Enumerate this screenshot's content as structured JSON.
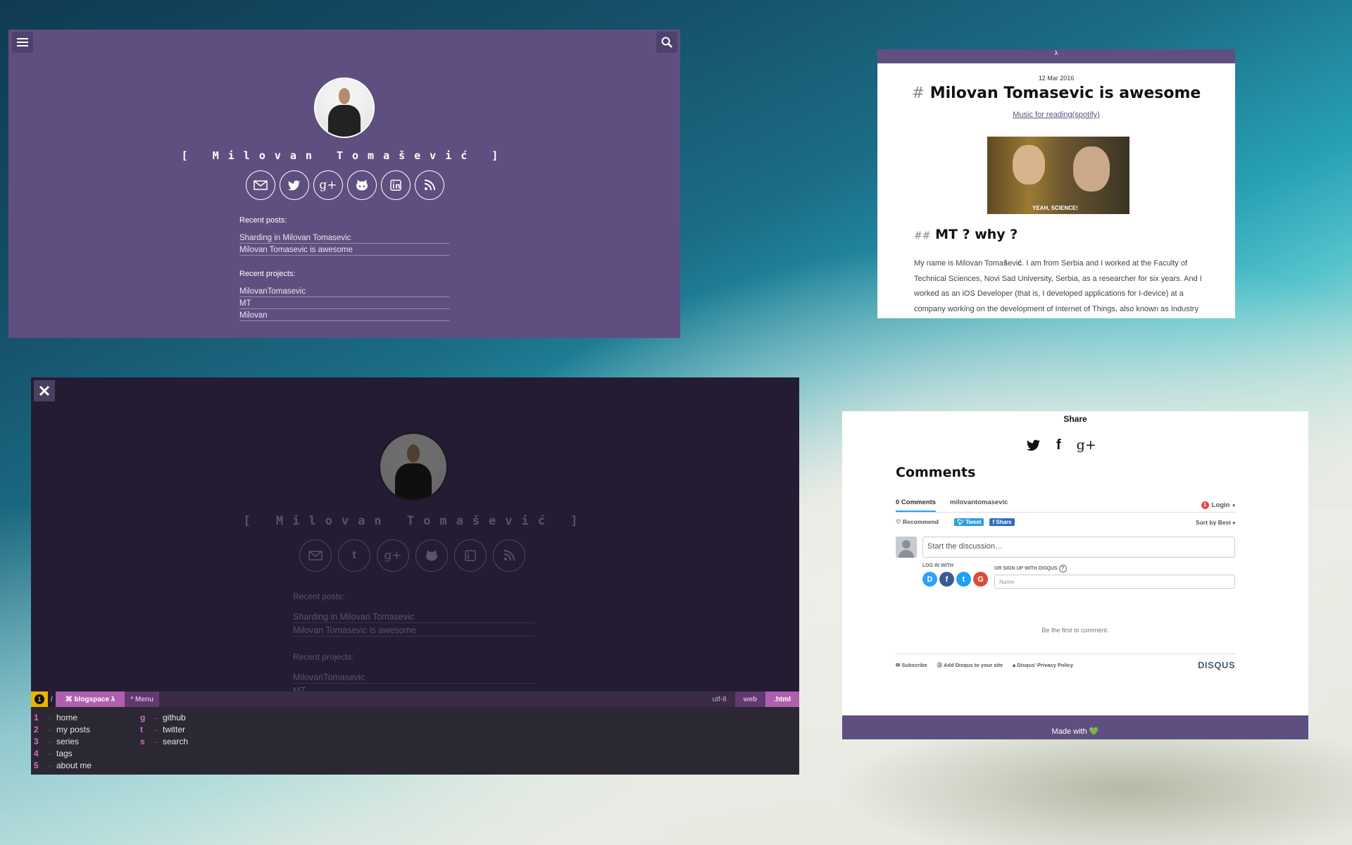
{
  "profile": {
    "name": "[ Milovan Tomašević ]",
    "recent_posts_label": "Recent posts:",
    "recent_posts": [
      "Sharding in Milovan Tomasevic",
      "Milovan Tomasevic is awesome"
    ],
    "recent_projects_label": "Recent projects:",
    "recent_projects": [
      "MilovanTomasevic",
      "MT",
      "Milovan"
    ],
    "socials": [
      "mail-icon",
      "twitter-icon",
      "google-plus-icon",
      "github-icon",
      "linkedin-icon",
      "rss-icon"
    ]
  },
  "post": {
    "topbar": "λ",
    "date": "12 Mar 2016",
    "hash": "#",
    "title": "Milovan Tomasevic is awesome",
    "music_link": "Music for reading(spotify)",
    "gif_caption": "YEAH, SCIENCE!",
    "h2_hash": "##",
    "h2": "MT ? why ?",
    "paragraph_start": "My name is Milovan Toma",
    "paragraph_mid": "š",
    "paragraph_mid2": "evi",
    "paragraph_bold": "ć",
    "paragraph_rest": ". I am from Serbia and I worked at the Faculty of Technical Sciences, Novi Sad University, Serbia, as a researcher for six years. And I worked as an iOS Developer (that is, I developed applications for I-device) at a company working on the development of Internet of Things, also known as Industry"
  },
  "dark": {
    "name": "[ Milovan Tomašević ]",
    "recent_posts_label": "Recent posts:",
    "recent_posts": [
      "Sharding in Milovan Tomasevic",
      "Milovan Tomasevic is awesome"
    ],
    "recent_projects_label": "Recent projects:",
    "recent_projects": [
      "MilovanTomasevic",
      "MT"
    ],
    "statusbar": {
      "num": "1",
      "slash": "/",
      "blogspace": "⌘ blogspace λ",
      "menu": "* Menu",
      "encoding": "utf-8",
      "web": "web",
      "ext": ".html"
    },
    "menu_left": [
      {
        "key": "1",
        "label": "home"
      },
      {
        "key": "2",
        "label": "my posts"
      },
      {
        "key": "3",
        "label": "series"
      },
      {
        "key": "4",
        "label": "tags"
      },
      {
        "key": "5",
        "label": "about me"
      }
    ],
    "menu_right": [
      {
        "key": "g",
        "label": "github"
      },
      {
        "key": "t",
        "label": "twitter"
      },
      {
        "key": "s",
        "label": "search"
      }
    ],
    "arrow": "→"
  },
  "comments": {
    "share": "Share",
    "title": "Comments",
    "tab_comments": "0 Comments",
    "tab_site": "milovantomasevic",
    "login_badge": "1",
    "login": "Login",
    "recommend": "♡ Recommend",
    "tweet": "Tweet",
    "fshare": "f Share",
    "sort": "Sort by Best",
    "start_discussion": "Start the discussion…",
    "log_in_with": "LOG IN WITH",
    "or_sign_up": "OR SIGN UP WITH DISQUS",
    "help": "?",
    "name_placeholder": "Name",
    "first_comment": "Be the first to comment.",
    "subscribe": "Subscribe",
    "add_disqus": "Add Disqus to your site",
    "privacy": "Disqus' Privacy Policy",
    "disqus_logo": "DISQUS",
    "login_services": [
      {
        "letter": "D",
        "color": "#2e9fff"
      },
      {
        "letter": "f",
        "color": "#3b5998"
      },
      {
        "letter": "t",
        "color": "#1da1f2"
      },
      {
        "letter": "G",
        "color": "#dd4b39"
      }
    ],
    "made_with": "Made with 💚"
  },
  "colors": {
    "purple": "#5f4f80",
    "dark": "#241c33",
    "accent_pink": "#d36fc6"
  }
}
